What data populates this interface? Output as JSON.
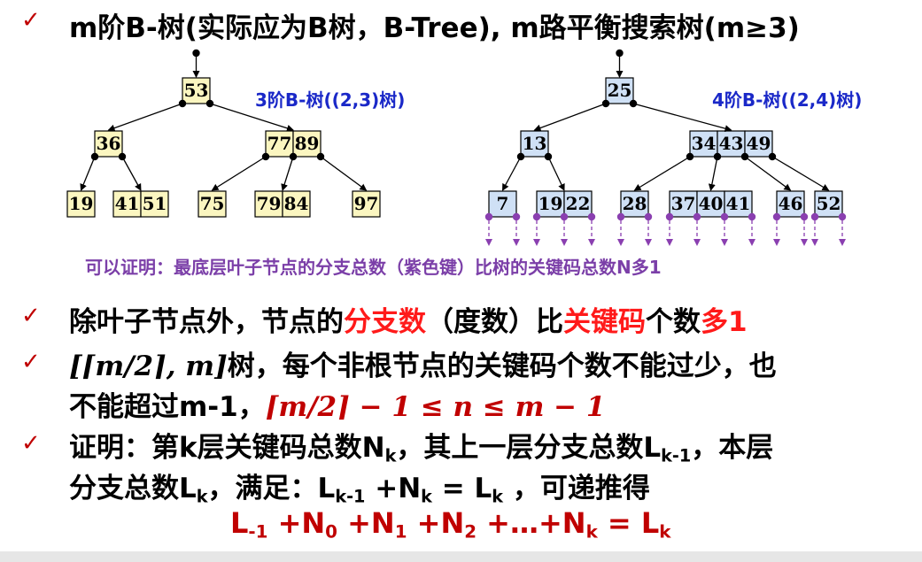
{
  "title": {
    "text": "m阶B-树(实际应为B树，B-Tree), m路平衡搜索树(m≥3)"
  },
  "trees": [
    {
      "label": "3阶B-树((2,3)树)",
      "fill": "#fbf6c0",
      "root": [
        "53"
      ],
      "level1": [
        [
          "36"
        ],
        [
          "77",
          "89"
        ]
      ],
      "leaves": [
        [
          "19"
        ],
        [
          "41",
          "51"
        ],
        [
          "75"
        ],
        [
          "79",
          "84"
        ],
        [
          "97"
        ]
      ]
    },
    {
      "label": "4阶B-树((2,4)树)",
      "fill": "#cfe0f5",
      "root": [
        "25"
      ],
      "level1": [
        [
          "13"
        ],
        [
          "34",
          "43",
          "49"
        ]
      ],
      "leaves": [
        [
          "7"
        ],
        [
          "19",
          "22"
        ],
        [
          "28"
        ],
        [
          "37",
          "40",
          "41"
        ],
        [
          "46"
        ],
        [
          "52"
        ]
      ]
    }
  ],
  "note": "可以证明：最底层叶子节点的分支总数（紫色键）比树的关键码总数N多1",
  "bullets": {
    "b1": {
      "p1": "除叶子节点外，节点的",
      "r1": "分支数",
      "p2": "（度数）比",
      "r2": "关键码",
      "p3": "个数",
      "r3": "多1"
    },
    "b2": {
      "math1": "[⌈m/2⌉, m]",
      "t1": "树，每个非根节点的关键码个数不能过少，也",
      "t2": "不能超过m-1，",
      "math2": "⌈m/2⌉ − 1 ≤ n ≤ m − 1"
    },
    "b3": {
      "l1a": "证明：第k层关键码总数N",
      "l1b": "k",
      "l1c": "，其上一层分支总数L",
      "l1d": "k-1",
      "l1e": "，本层",
      "l2a": "分支总数L",
      "l2b": "k",
      "l2c": "，满足：L",
      "l2d": "k-1",
      "l2e": " +N",
      "l2f": "k",
      "l2g": " = L",
      "l2h": "k",
      "l2i": " ，可递推得"
    }
  },
  "formula": {
    "L": "L",
    "Lsub": "-1",
    "p0": " +N",
    "s0": "0",
    "p1": " +N",
    "s1": "1",
    "p2": " +N",
    "s2": "2",
    "p3": " +…+N",
    "s3": "k",
    "eq": " = L",
    "s4": "k"
  },
  "check_glyph": "✓",
  "colors": {
    "accent_red": "#c00000",
    "bright_red": "#ff1a1a",
    "purple": "#7b3fa8",
    "blue_label": "#1a28c8"
  }
}
